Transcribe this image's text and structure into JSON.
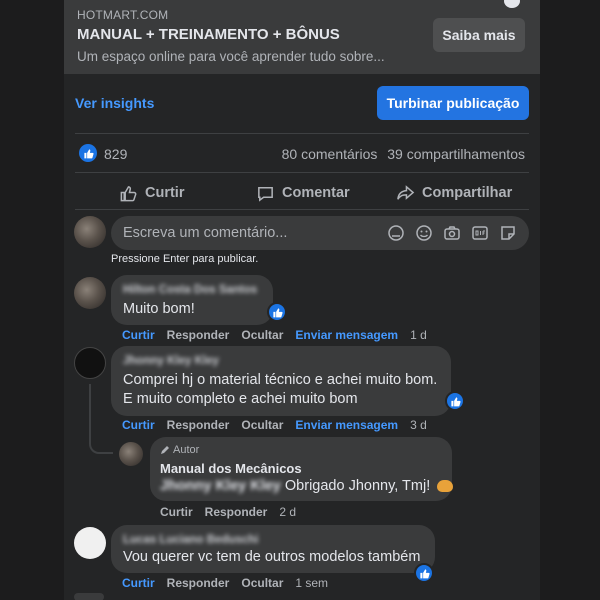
{
  "link_preview": {
    "domain": "HOTMART.COM",
    "title": "MANUAL + TREINAMENTO + BÔNUS",
    "description": "Um espaço online para você aprender tudo sobre...",
    "button": "Saiba mais"
  },
  "post_actions_top": {
    "insights": "Ver insights",
    "boost": "Turbinar publicação"
  },
  "stats": {
    "reactions": "829",
    "comments": "80 comentários",
    "shares": "39 compartilhamentos"
  },
  "actions": {
    "like": "Curtir",
    "comment": "Comentar",
    "share": "Compartilhar"
  },
  "comment_input": {
    "placeholder": "Escreva um comentário...",
    "hint": "Pressione Enter para publicar."
  },
  "comments": [
    {
      "author": "Hilton Costa Dos Santos",
      "text": "Muito bom!",
      "actions": [
        "Curtir",
        "Responder",
        "Ocultar",
        "Enviar mensagem"
      ],
      "time": "1 d"
    },
    {
      "author": "Jhonny Kley Kley",
      "text_lines": [
        "Comprei hj o material técnico e achei muito bom.",
        "E muito completo e achei muito bom"
      ],
      "actions": [
        "Curtir",
        "Responder",
        "Ocultar",
        "Enviar mensagem"
      ],
      "time": "3 d",
      "reply": {
        "tag": "Autor",
        "author": "Manual dos Mecânicos",
        "mention": "Jhonny Kley Kley",
        "text": "Obrigado Jhonny, Tmj!",
        "actions": [
          "Curtir",
          "Responder"
        ],
        "time": "2 d"
      }
    },
    {
      "author": "Lucas Luciano Beduschi",
      "text": "Vou querer vc tem de outros modelos também",
      "actions": [
        "Curtir",
        "Responder",
        "Ocultar"
      ],
      "time": "1 sem"
    }
  ],
  "colors": {
    "card_bg": "#242526",
    "bubble_bg": "#3a3b3c",
    "accent_blue": "#2374e1",
    "link_blue": "#4599ff",
    "secondary_text": "#b0b3b8"
  }
}
